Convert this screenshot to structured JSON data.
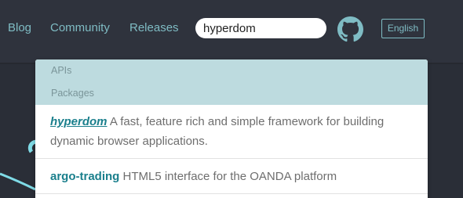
{
  "nav": {
    "links": [
      {
        "label": "Blog"
      },
      {
        "label": "Community"
      },
      {
        "label": "Releases"
      }
    ],
    "search": {
      "value": "hyperdom"
    },
    "github_icon": "github-icon",
    "language": "English"
  },
  "dropdown": {
    "categories": [
      "APIs",
      "Packages"
    ],
    "results": [
      {
        "name": "hyperdom",
        "description": " A fast, feature rich and simple framework for building dynamic browser applications."
      },
      {
        "name": "argo-trading",
        "description": " HTML5 interface for the OANDA platform"
      }
    ]
  },
  "colors": {
    "nav_bg": "#2f333d",
    "accent": "#7fbcc4",
    "category_bg": "#bddbdf",
    "result_name": "#1a7f8c"
  }
}
